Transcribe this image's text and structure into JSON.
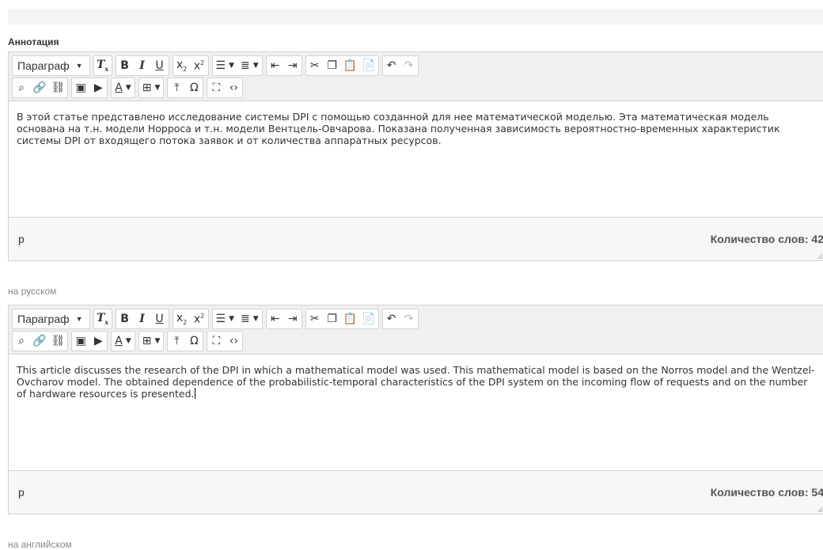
{
  "section_label": "Аннотация",
  "toolbar": {
    "format_select": "Параграф"
  },
  "editors": [
    {
      "content": "В этой статье представлено исследование системы DPI с помощью созданной для нее математической моделью. Эта математическая модель основана на т.н. модели Норроса и т.н. модели Вентцель-Овчарова. Показана полученная зависимость вероятностно-временных характеристик системы DPI от входящего потока заявок и от количества аппаратных ресурсов.",
      "status_path": "p",
      "wordcount": "Количество слов: 42",
      "lang_label": "на русском"
    },
    {
      "content": "This article discusses the research of the DPI in which a mathematical model was used. This mathematical model is based on the Norros model and the Wentzel-Ovcharov model. The obtained dependence of the probabilistic-temporal characteristics of the DPI system on the incoming flow of requests and on the number of hardware resources is presented.",
      "status_path": "p",
      "wordcount": "Количество слов: 54",
      "lang_label": "на английском"
    }
  ],
  "colors": {
    "toolbar_bg": "#f0f0f0",
    "border": "#d3d3d3",
    "label": "#888888"
  }
}
